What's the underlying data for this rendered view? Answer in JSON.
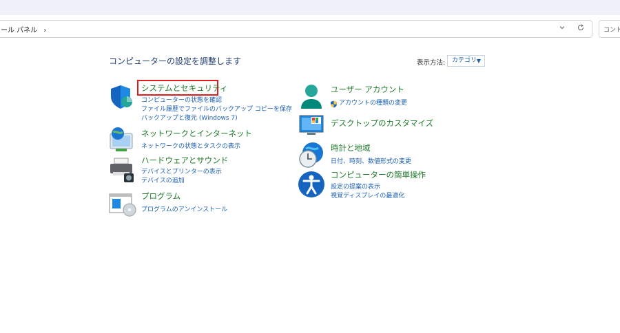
{
  "address_bar": {
    "breadcrumb": "ール パネル",
    "separator": "›",
    "dropdown_icon": "chevron-down-icon",
    "refresh_icon": "refresh-icon"
  },
  "search": {
    "placeholder": "コントロ"
  },
  "header": {
    "title": "コンピューターの設定を調整します",
    "view_by_label": "表示方法:",
    "view_by_value": "カテゴリ",
    "view_by_caret": "▼"
  },
  "categories_left": [
    {
      "title": "システムとセキュリティ",
      "icon": "shield-icon",
      "links": [
        "コンピューターの状態を確認",
        "ファイル履歴でファイルのバックアップ コピーを保存",
        "バックアップと復元 (Windows 7)"
      ]
    },
    {
      "title": "ネットワークとインターネット",
      "icon": "network-icon",
      "links": [
        "ネットワークの状態とタスクの表示"
      ]
    },
    {
      "title": "ハードウェアとサウンド",
      "icon": "printer-icon",
      "links": [
        "デバイスとプリンターの表示",
        "デバイスの追加"
      ]
    },
    {
      "title": "プログラム",
      "icon": "programs-icon",
      "links": [
        "プログラムのアンインストール"
      ]
    }
  ],
  "categories_right": [
    {
      "title": "ユーザー アカウント",
      "icon": "user-icon",
      "links": [
        "アカウントの種類の変更"
      ]
    },
    {
      "title": "デスクトップのカスタマイズ",
      "icon": "monitor-icon",
      "links": []
    },
    {
      "title": "時計と地域",
      "icon": "clock-globe-icon",
      "links": [
        "日付、時刻、数値形式の変更"
      ]
    },
    {
      "title": "コンピューターの簡単操作",
      "icon": "accessibility-icon",
      "links": [
        "設定の提案の表示",
        "視覚ディスプレイの最適化"
      ]
    }
  ],
  "colors": {
    "accent_link": "#1a5fb4",
    "category_title": "#1f7a2a",
    "highlight": "#e01b1b"
  }
}
